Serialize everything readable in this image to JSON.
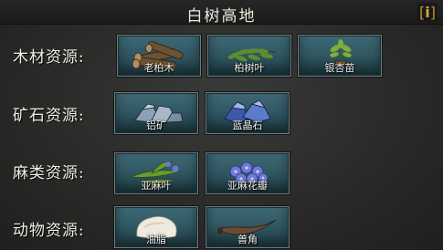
{
  "header": {
    "title": "白树高地",
    "info_label": "i"
  },
  "categories": [
    {
      "label": "木材资源:",
      "items": [
        {
          "name": "老柏木"
        },
        {
          "name": "柏树叶"
        },
        {
          "name": "银杏苗"
        }
      ]
    },
    {
      "label": "矿石资源:",
      "items": [
        {
          "name": "铝矿"
        },
        {
          "name": "蓝晶石"
        }
      ]
    },
    {
      "label": "麻类资源:",
      "items": [
        {
          "name": "亚麻叶"
        },
        {
          "name": "亚麻花瓣"
        }
      ]
    },
    {
      "label": "动物资源:",
      "items": [
        {
          "name": "油脂"
        },
        {
          "name": "兽角"
        }
      ]
    }
  ],
  "colors": {
    "slot_teal": "#2e5560",
    "title_text": "#ece8dc",
    "info_gold": "#d6a640"
  }
}
